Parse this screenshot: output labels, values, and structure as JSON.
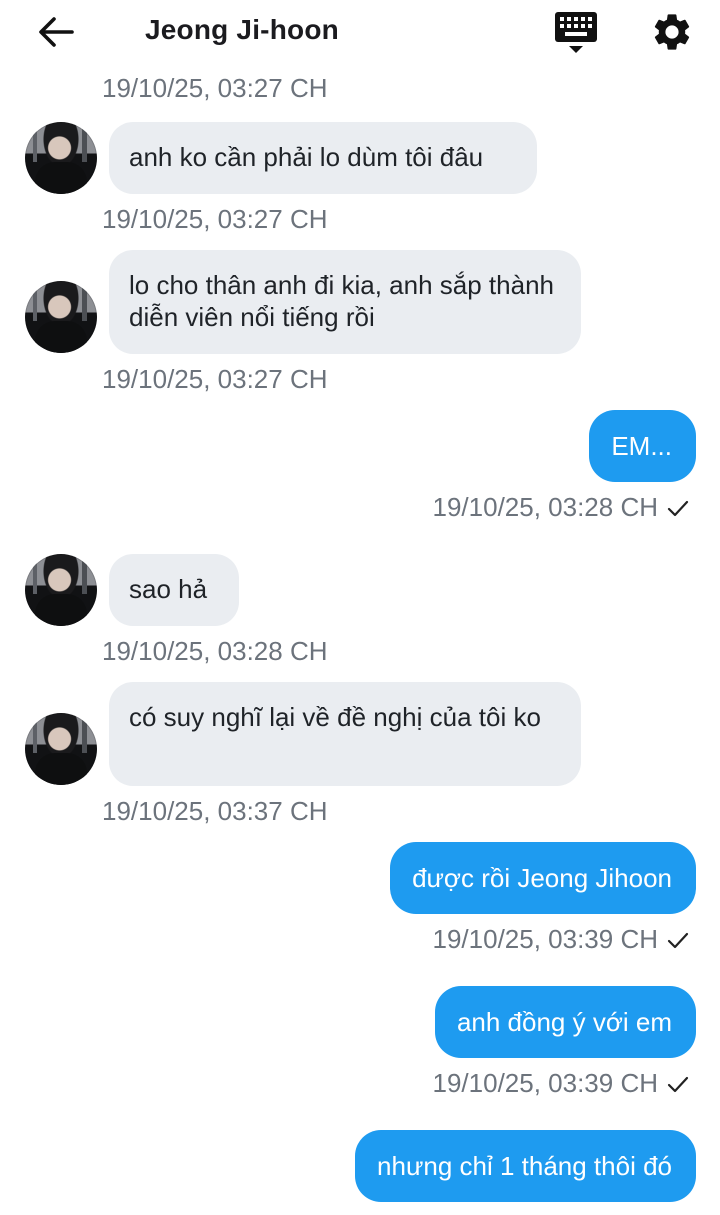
{
  "header": {
    "title": "Jeong Ji-hoon",
    "back_icon": "arrow-left-icon",
    "keyboard_icon": "keyboard-icon",
    "settings_icon": "gear-icon"
  },
  "colors": {
    "incoming_bubble": "#eaedf1",
    "outgoing_bubble": "#1e9bf0",
    "timestamp": "#6c737c"
  },
  "messages": [
    {
      "dir": "in",
      "text": "",
      "time": "19/10/25, 03:27 CH"
    },
    {
      "dir": "in",
      "text": "anh ko cần phải lo dùm tôi đâu",
      "time": "19/10/25, 03:27 CH"
    },
    {
      "dir": "in",
      "text": "lo cho thân anh đi kia, anh sắp thành diễn viên nổi tiếng rồi",
      "time": "19/10/25, 03:27 CH"
    },
    {
      "dir": "out",
      "text": "EM...",
      "time": "19/10/25, 03:28 CH",
      "status": "sent"
    },
    {
      "dir": "in",
      "text": "sao hả",
      "time": "19/10/25, 03:28 CH"
    },
    {
      "dir": "in",
      "text": "có suy nghĩ lại về đề nghị của tôi ko",
      "time": "19/10/25, 03:37 CH"
    },
    {
      "dir": "out",
      "text": "được rồi Jeong Jihoon",
      "time": "19/10/25, 03:39 CH",
      "status": "sent"
    },
    {
      "dir": "out",
      "text": "anh đồng ý với em",
      "time": "19/10/25, 03:39 CH",
      "status": "sent"
    },
    {
      "dir": "out",
      "text": "nhưng chỉ 1 tháng thôi đó",
      "time": "",
      "status": ""
    }
  ]
}
